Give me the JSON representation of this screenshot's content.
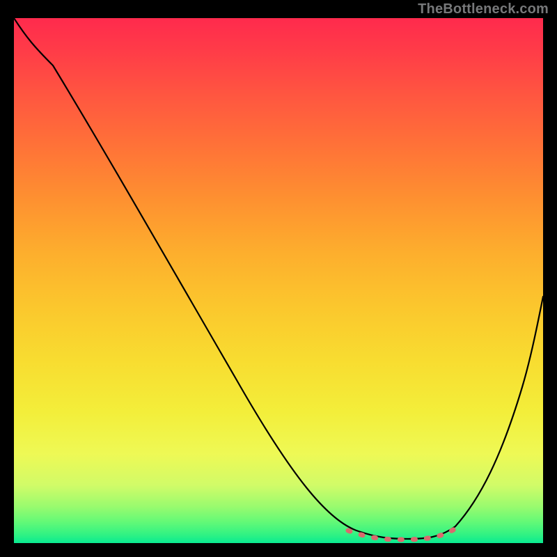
{
  "attribution": "TheBottleneck.com",
  "colors": {
    "background": "#000000",
    "gradient_top": "#ff2a4d",
    "gradient_bottom": "#09ea91",
    "curve": "#000000",
    "trough_marker": "#d96a6e",
    "attribution_text": "#77787a"
  },
  "chart_data": {
    "type": "line",
    "title": "",
    "xlabel": "",
    "ylabel": "",
    "xlim": [
      0,
      100
    ],
    "ylim": [
      0,
      100
    ],
    "grid": false,
    "legend": false,
    "annotations": [
      {
        "kind": "dotted-segment",
        "color": "#d96a6e",
        "x_range": [
          63,
          83
        ],
        "y": 98
      }
    ],
    "series": [
      {
        "name": "bottleneck-curve",
        "x": [
          0,
          4,
          8,
          15,
          20,
          26,
          32,
          38,
          44,
          50,
          56,
          62,
          66,
          70,
          74,
          78,
          82,
          86,
          90,
          94,
          98,
          100
        ],
        "y": [
          100,
          97,
          93,
          86,
          80,
          72,
          64,
          56,
          47,
          38,
          28,
          17,
          10,
          5,
          2,
          2,
          3,
          9,
          19,
          31,
          44,
          51
        ]
      }
    ]
  }
}
